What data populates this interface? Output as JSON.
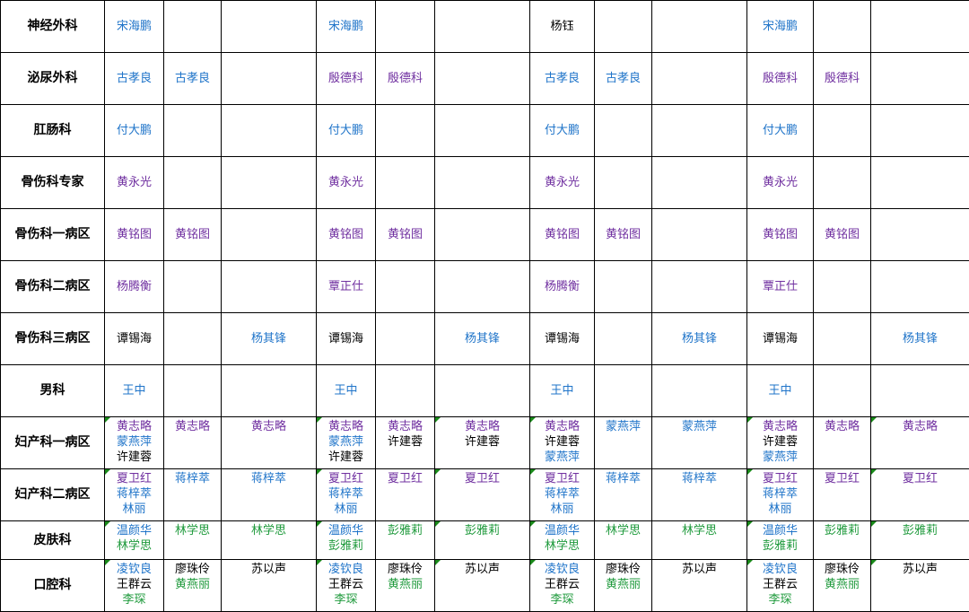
{
  "palette": {
    "blue": "#1f74c9",
    "purple": "#7030a0",
    "green": "#1f9a3c",
    "black": "#000000",
    "flag": "#1a8a1a"
  },
  "rows": [
    {
      "dept": "神经外科",
      "cells": [
        [
          {
            "t": "宋海鹏",
            "c": "blue"
          }
        ],
        [],
        [],
        [
          {
            "t": "宋海鹏",
            "c": "blue"
          }
        ],
        [],
        [],
        [
          {
            "t": "杨钰",
            "c": "black"
          }
        ],
        [],
        [],
        [
          {
            "t": "宋海鹏",
            "c": "blue"
          }
        ],
        [],
        []
      ]
    },
    {
      "dept": "泌尿外科",
      "cells": [
        [
          {
            "t": "古孝良",
            "c": "blue"
          }
        ],
        [
          {
            "t": "古孝良",
            "c": "blue"
          }
        ],
        [],
        [
          {
            "t": "殷德科",
            "c": "purple"
          }
        ],
        [
          {
            "t": "殷德科",
            "c": "purple"
          }
        ],
        [],
        [
          {
            "t": "古孝良",
            "c": "blue"
          }
        ],
        [
          {
            "t": "古孝良",
            "c": "blue"
          }
        ],
        [],
        [
          {
            "t": "殷德科",
            "c": "purple"
          }
        ],
        [
          {
            "t": "殷德科",
            "c": "purple"
          }
        ],
        []
      ]
    },
    {
      "dept": "肛肠科",
      "cells": [
        [
          {
            "t": "付大鹏",
            "c": "blue"
          }
        ],
        [],
        [],
        [
          {
            "t": "付大鹏",
            "c": "blue"
          }
        ],
        [],
        [],
        [
          {
            "t": "付大鹏",
            "c": "blue"
          }
        ],
        [],
        [],
        [
          {
            "t": "付大鹏",
            "c": "blue"
          }
        ],
        [],
        []
      ]
    },
    {
      "dept": "骨伤科专家",
      "cells": [
        [
          {
            "t": "黄永光",
            "c": "purple"
          }
        ],
        [],
        [],
        [
          {
            "t": "黄永光",
            "c": "purple"
          }
        ],
        [],
        [],
        [
          {
            "t": "黄永光",
            "c": "purple"
          }
        ],
        [],
        [],
        [
          {
            "t": "黄永光",
            "c": "purple"
          }
        ],
        [],
        []
      ]
    },
    {
      "dept": "骨伤科一病区",
      "cells": [
        [
          {
            "t": "黄铭图",
            "c": "purple"
          }
        ],
        [
          {
            "t": "黄铭图",
            "c": "purple"
          }
        ],
        [],
        [
          {
            "t": "黄铭图",
            "c": "purple"
          }
        ],
        [
          {
            "t": "黄铭图",
            "c": "purple"
          }
        ],
        [],
        [
          {
            "t": "黄铭图",
            "c": "purple"
          }
        ],
        [
          {
            "t": "黄铭图",
            "c": "purple"
          }
        ],
        [],
        [
          {
            "t": "黄铭图",
            "c": "purple"
          }
        ],
        [
          {
            "t": "黄铭图",
            "c": "purple"
          }
        ],
        []
      ]
    },
    {
      "dept": "骨伤科二病区",
      "cells": [
        [
          {
            "t": "杨腾衡",
            "c": "purple"
          }
        ],
        [],
        [],
        [
          {
            "t": "覃正仕",
            "c": "purple"
          }
        ],
        [],
        [],
        [
          {
            "t": "杨腾衡",
            "c": "purple"
          }
        ],
        [],
        [],
        [
          {
            "t": "覃正仕",
            "c": "purple"
          }
        ],
        [],
        []
      ]
    },
    {
      "dept": "骨伤科三病区",
      "cells": [
        [
          {
            "t": "谭锡海",
            "c": "black"
          }
        ],
        [],
        [
          {
            "t": "杨其锋",
            "c": "blue"
          }
        ],
        [
          {
            "t": "谭锡海",
            "c": "black"
          }
        ],
        [],
        [
          {
            "t": "杨其锋",
            "c": "blue"
          }
        ],
        [
          {
            "t": "谭锡海",
            "c": "black"
          }
        ],
        [],
        [
          {
            "t": "杨其锋",
            "c": "blue"
          }
        ],
        [
          {
            "t": "谭锡海",
            "c": "black"
          }
        ],
        [],
        [
          {
            "t": "杨其锋",
            "c": "blue"
          }
        ]
      ]
    },
    {
      "dept": "男科",
      "cells": [
        [
          {
            "t": "王中",
            "c": "blue"
          }
        ],
        [],
        [],
        [
          {
            "t": "王中",
            "c": "blue"
          }
        ],
        [],
        [],
        [
          {
            "t": "王中",
            "c": "blue"
          }
        ],
        [],
        [],
        [
          {
            "t": "王中",
            "c": "blue"
          }
        ],
        [],
        []
      ]
    },
    {
      "dept": "妇产科一病区",
      "cells": [
        [
          {
            "t": "黄志略",
            "c": "purple"
          },
          {
            "t": "蒙燕萍",
            "c": "blue"
          },
          {
            "t": "许建蓉",
            "c": "black"
          }
        ],
        [
          {
            "t": "黄志略",
            "c": "purple"
          }
        ],
        [
          {
            "t": "黄志略",
            "c": "purple"
          }
        ],
        [
          {
            "t": "黄志略",
            "c": "purple"
          },
          {
            "t": "蒙燕萍",
            "c": "blue"
          },
          {
            "t": "许建蓉",
            "c": "black"
          }
        ],
        [
          {
            "t": "黄志略",
            "c": "purple"
          },
          {
            "t": "许建蓉",
            "c": "black"
          }
        ],
        [
          {
            "t": "黄志略",
            "c": "purple"
          },
          {
            "t": "许建蓉",
            "c": "black"
          }
        ],
        [
          {
            "t": "黄志略",
            "c": "purple"
          },
          {
            "t": "许建蓉",
            "c": "black"
          },
          {
            "t": "蒙燕萍",
            "c": "blue"
          }
        ],
        [
          {
            "t": "蒙燕萍",
            "c": "blue"
          }
        ],
        [
          {
            "t": "蒙燕萍",
            "c": "blue"
          }
        ],
        [
          {
            "t": "黄志略",
            "c": "purple"
          },
          {
            "t": "许建蓉",
            "c": "black"
          },
          {
            "t": "蒙燕萍",
            "c": "blue"
          }
        ],
        [
          {
            "t": "黄志略",
            "c": "purple"
          }
        ],
        [
          {
            "t": "黄志略",
            "c": "purple"
          }
        ]
      ]
    },
    {
      "dept": "妇产科二病区",
      "cells": [
        [
          {
            "t": "夏卫红",
            "c": "purple"
          },
          {
            "t": "蒋梓萃",
            "c": "blue"
          },
          {
            "t": "林丽",
            "c": "blue"
          }
        ],
        [
          {
            "t": "蒋梓萃",
            "c": "blue"
          }
        ],
        [
          {
            "t": "蒋梓萃",
            "c": "blue"
          }
        ],
        [
          {
            "t": "夏卫红",
            "c": "purple"
          },
          {
            "t": "蒋梓萃",
            "c": "blue"
          },
          {
            "t": "林丽",
            "c": "blue"
          }
        ],
        [
          {
            "t": "夏卫红",
            "c": "purple"
          }
        ],
        [
          {
            "t": "夏卫红",
            "c": "purple"
          }
        ],
        [
          {
            "t": "夏卫红",
            "c": "purple"
          },
          {
            "t": "蒋梓萃",
            "c": "blue"
          },
          {
            "t": "林丽",
            "c": "blue"
          }
        ],
        [
          {
            "t": "蒋梓萃",
            "c": "blue"
          }
        ],
        [
          {
            "t": "蒋梓萃",
            "c": "blue"
          }
        ],
        [
          {
            "t": "夏卫红",
            "c": "purple"
          },
          {
            "t": "蒋梓萃",
            "c": "blue"
          },
          {
            "t": "林丽",
            "c": "blue"
          }
        ],
        [
          {
            "t": "夏卫红",
            "c": "purple"
          }
        ],
        [
          {
            "t": "夏卫红",
            "c": "purple"
          }
        ]
      ]
    },
    {
      "dept": "皮肤科",
      "cells": [
        [
          {
            "t": "温颜华",
            "c": "blue"
          },
          {
            "t": "林学思",
            "c": "green"
          }
        ],
        [
          {
            "t": "林学思",
            "c": "green"
          }
        ],
        [
          {
            "t": "林学思",
            "c": "green"
          }
        ],
        [
          {
            "t": "温颜华",
            "c": "blue"
          },
          {
            "t": "彭雅莉",
            "c": "green"
          }
        ],
        [
          {
            "t": "彭雅莉",
            "c": "green"
          }
        ],
        [
          {
            "t": "彭雅莉",
            "c": "green"
          }
        ],
        [
          {
            "t": "温颜华",
            "c": "blue"
          },
          {
            "t": "林学思",
            "c": "green"
          }
        ],
        [
          {
            "t": "林学思",
            "c": "green"
          }
        ],
        [
          {
            "t": "林学思",
            "c": "green"
          }
        ],
        [
          {
            "t": "温颜华",
            "c": "blue"
          },
          {
            "t": "彭雅莉",
            "c": "green"
          }
        ],
        [
          {
            "t": "彭雅莉",
            "c": "green"
          }
        ],
        [
          {
            "t": "彭雅莉",
            "c": "green"
          }
        ]
      ]
    },
    {
      "dept": "口腔科",
      "cells": [
        [
          {
            "t": "凌钦良",
            "c": "blue"
          },
          {
            "t": "王群云",
            "c": "black"
          },
          {
            "t": "李琛",
            "c": "green"
          }
        ],
        [
          {
            "t": "廖珠伶",
            "c": "black"
          },
          {
            "t": "黄燕丽",
            "c": "green"
          }
        ],
        [
          {
            "t": "苏以声",
            "c": "black"
          }
        ],
        [
          {
            "t": "凌钦良",
            "c": "blue"
          },
          {
            "t": "王群云",
            "c": "black"
          },
          {
            "t": "李琛",
            "c": "green"
          }
        ],
        [
          {
            "t": "廖珠伶",
            "c": "black"
          },
          {
            "t": "黄燕丽",
            "c": "green"
          }
        ],
        [
          {
            "t": "苏以声",
            "c": "black"
          }
        ],
        [
          {
            "t": "凌钦良",
            "c": "blue"
          },
          {
            "t": "王群云",
            "c": "black"
          },
          {
            "t": "李琛",
            "c": "green"
          }
        ],
        [
          {
            "t": "廖珠伶",
            "c": "black"
          },
          {
            "t": "黄燕丽",
            "c": "green"
          }
        ],
        [
          {
            "t": "苏以声",
            "c": "black"
          }
        ],
        [
          {
            "t": "凌钦良",
            "c": "blue"
          },
          {
            "t": "王群云",
            "c": "black"
          },
          {
            "t": "李琛",
            "c": "green"
          }
        ],
        [
          {
            "t": "廖珠伶",
            "c": "black"
          },
          {
            "t": "黄燕丽",
            "c": "green"
          }
        ],
        [
          {
            "t": "苏以声",
            "c": "black"
          }
        ]
      ]
    }
  ]
}
